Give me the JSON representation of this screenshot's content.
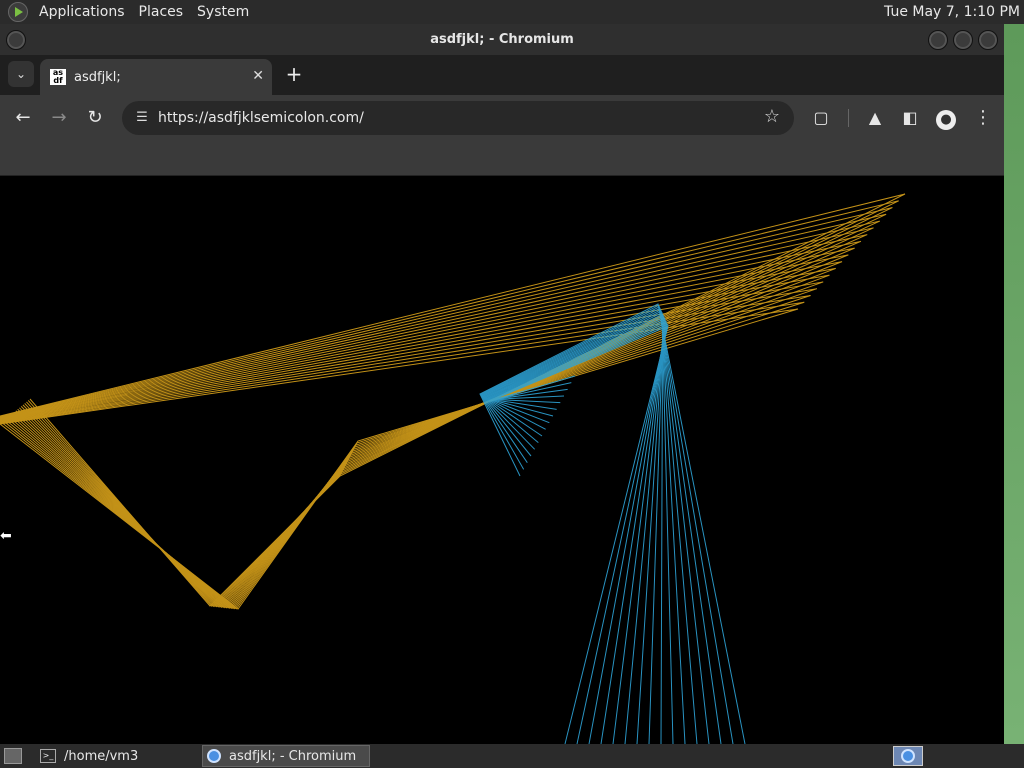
{
  "top_panel": {
    "menus": [
      "Applications",
      "Places",
      "System"
    ],
    "clock": "Tue May  7,  1:10 PM"
  },
  "window": {
    "title": "asdfjkl; - Chromium"
  },
  "browser": {
    "tab": {
      "title": "asdfjkl;",
      "favicon_text": "as df"
    },
    "url": "https://asdfjklsemicolon.com/"
  },
  "icons": {
    "back": "arrow-left-icon",
    "forward": "arrow-right-icon",
    "reload": "reload-icon",
    "site_info": "tune-icon",
    "bookmark": "star-icon",
    "extensions": "puzzle-icon",
    "labs": "flask-icon",
    "side_panel": "side-panel-icon",
    "profile": "person-icon",
    "menu": "kebab-menu-icon"
  },
  "colors": {
    "gold_lines": "#d9a21b",
    "blue_lines": "#2ea3d6",
    "panel_bg": "#2b2b2b",
    "toolbar_bg": "#3a3a3a"
  },
  "taskbar": {
    "tasks": [
      {
        "label": "/home/vm3"
      },
      {
        "label": "asdfjkl; - Chromium"
      }
    ]
  }
}
